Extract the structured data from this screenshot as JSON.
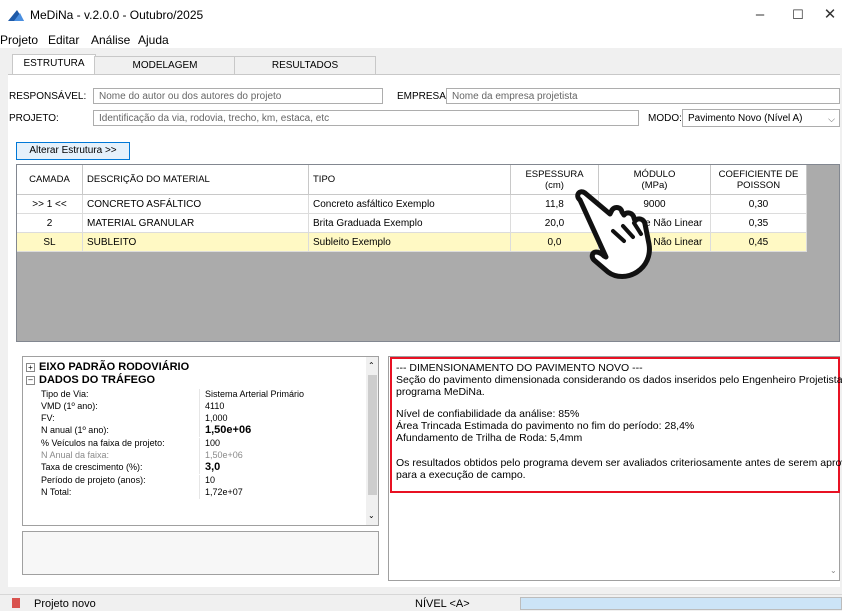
{
  "window": {
    "title": "MeDiNa - v.2.0.0 - Outubro/2025",
    "controls": [
      "–",
      "☐",
      "✕"
    ]
  },
  "menu": [
    "Projeto",
    "Editar",
    "Análise",
    "Ajuda"
  ],
  "tabs": [
    {
      "label": "ESTRUTURA",
      "active": true
    },
    {
      "label": "MODELAGEM",
      "active": false
    },
    {
      "label": "RESULTADOS",
      "active": false
    }
  ],
  "form": {
    "responsavel_label": "RESPONSÁVEL:",
    "responsavel_placeholder": "Nome do autor ou dos autores do projeto",
    "empresa_label": "EMPRESA:",
    "empresa_placeholder": "Nome da empresa projetista",
    "projeto_label": "PROJETO:",
    "projeto_placeholder": "Identificação da via, rodovia, trecho, km, estaca, etc",
    "modo_label": "MODO:",
    "modo_value": "Pavimento Novo (Nível A)"
  },
  "alter_button": "Alterar Estrutura >>",
  "grid": {
    "headers": [
      "CAMADA",
      "DESCRIÇÃO DO MATERIAL",
      "TIPO",
      "ESPESSURA\n(cm)",
      "MÓDULO\n(MPa)",
      "COEFICIENTE DE\nPOISSON"
    ],
    "rows": [
      {
        "camada": ">> 1 <<",
        "descricao": "CONCRETO ASFÁLTICO",
        "tipo": "Concreto asfáltico Exemplo",
        "espessura": "11,8",
        "modulo": "9000",
        "poisson": "0,30"
      },
      {
        "camada": "2",
        "descricao": "MATERIAL GRANULAR",
        "tipo": "Brita Graduada Exemplo",
        "espessura": "20,0",
        "modulo": "Resiliente Não Linear",
        "poisson": "0,35"
      },
      {
        "camada": "SL",
        "descricao": "SUBLEITO",
        "tipo": "Subleito Exemplo",
        "espessura": "0,0",
        "modulo": "Resiliente Não Linear",
        "poisson": "0,45"
      }
    ],
    "row_selected_color": "#fff9c4"
  },
  "properties": {
    "group1": "EIXO PADRÃO RODOVIÁRIO",
    "group2": "DADOS DO TRÁFEGO",
    "rows": [
      {
        "key": "Tipo de Via:",
        "value": "Sistema Arterial Primário"
      },
      {
        "key": "VMD (1º ano):",
        "value": "4110"
      },
      {
        "key": "FV:",
        "value": "1,000"
      },
      {
        "key": "N anual (1º ano):",
        "value": "1,50e+06"
      },
      {
        "key": "% Veículos na faixa de projeto:",
        "value": "100"
      },
      {
        "key": "N Anual da faixa:",
        "value": "1,50e+06"
      },
      {
        "key": "Taxa de crescimento (%):",
        "value": "3,0"
      },
      {
        "key": "Período de projeto (anos):",
        "value": "10"
      },
      {
        "key": "N Total:",
        "value": "1,72e+07"
      }
    ]
  },
  "results": {
    "lines": [
      "--- DIMENSIONAMENTO DO PAVIMENTO NOVO ---",
      "Seção do pavimento dimensionada considerando os dados inseridos pelo Engenheiro Projetista no",
      "programa MeDiNa.",
      "Nível de confiabilidade da análise: 85%",
      "Área Trincada Estimada do pavimento no fim do período: 28,4%",
      "Afundamento de Trilha de Roda: 5,4mm",
      "Os resultados obtidos pelo programa devem ser avaliados criteriosamente antes de serem aprovados",
      "para a execução de campo."
    ],
    "highlight_color": "#e81123"
  },
  "status": {
    "project": "Projeto novo",
    "level": "NÍVEL <A>"
  }
}
